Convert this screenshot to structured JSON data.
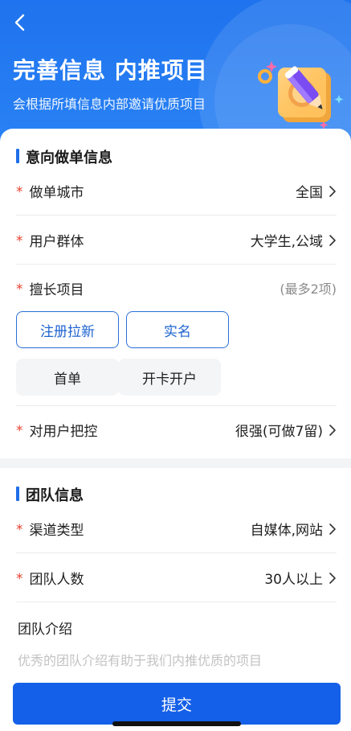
{
  "header": {
    "title": "完善信息 内推项目",
    "subtitle": "会根据所填信息内部邀请优质项目"
  },
  "intent_section": {
    "title": "意向做单信息",
    "city": {
      "label": "做单城市",
      "value": "全国"
    },
    "user_group": {
      "label": "用户群体",
      "value": "大学生,公域"
    },
    "skills": {
      "label": "擅长项目",
      "hint": "(最多2项)",
      "options": [
        {
          "label": "注册拉新",
          "selected": true
        },
        {
          "label": "实名",
          "selected": true
        },
        {
          "label": "首单",
          "selected": false
        },
        {
          "label": "开卡开户",
          "selected": false
        }
      ]
    },
    "control": {
      "label": "对用户把控",
      "value": "很强(可做7留)"
    }
  },
  "team_section": {
    "title": "团队信息",
    "channel": {
      "label": "渠道类型",
      "value": "自媒体,网站"
    },
    "size": {
      "label": "团队人数",
      "value": "30人以上"
    },
    "intro": {
      "label": "团队介绍",
      "placeholder": "优秀的团队介绍有助于我们内推优质的项目"
    }
  },
  "required_mark": "*",
  "submit_label": "提交",
  "colors": {
    "header_blue": "#1f73ee",
    "accent_blue": "#1560e8",
    "required_red": "#e8412f"
  }
}
